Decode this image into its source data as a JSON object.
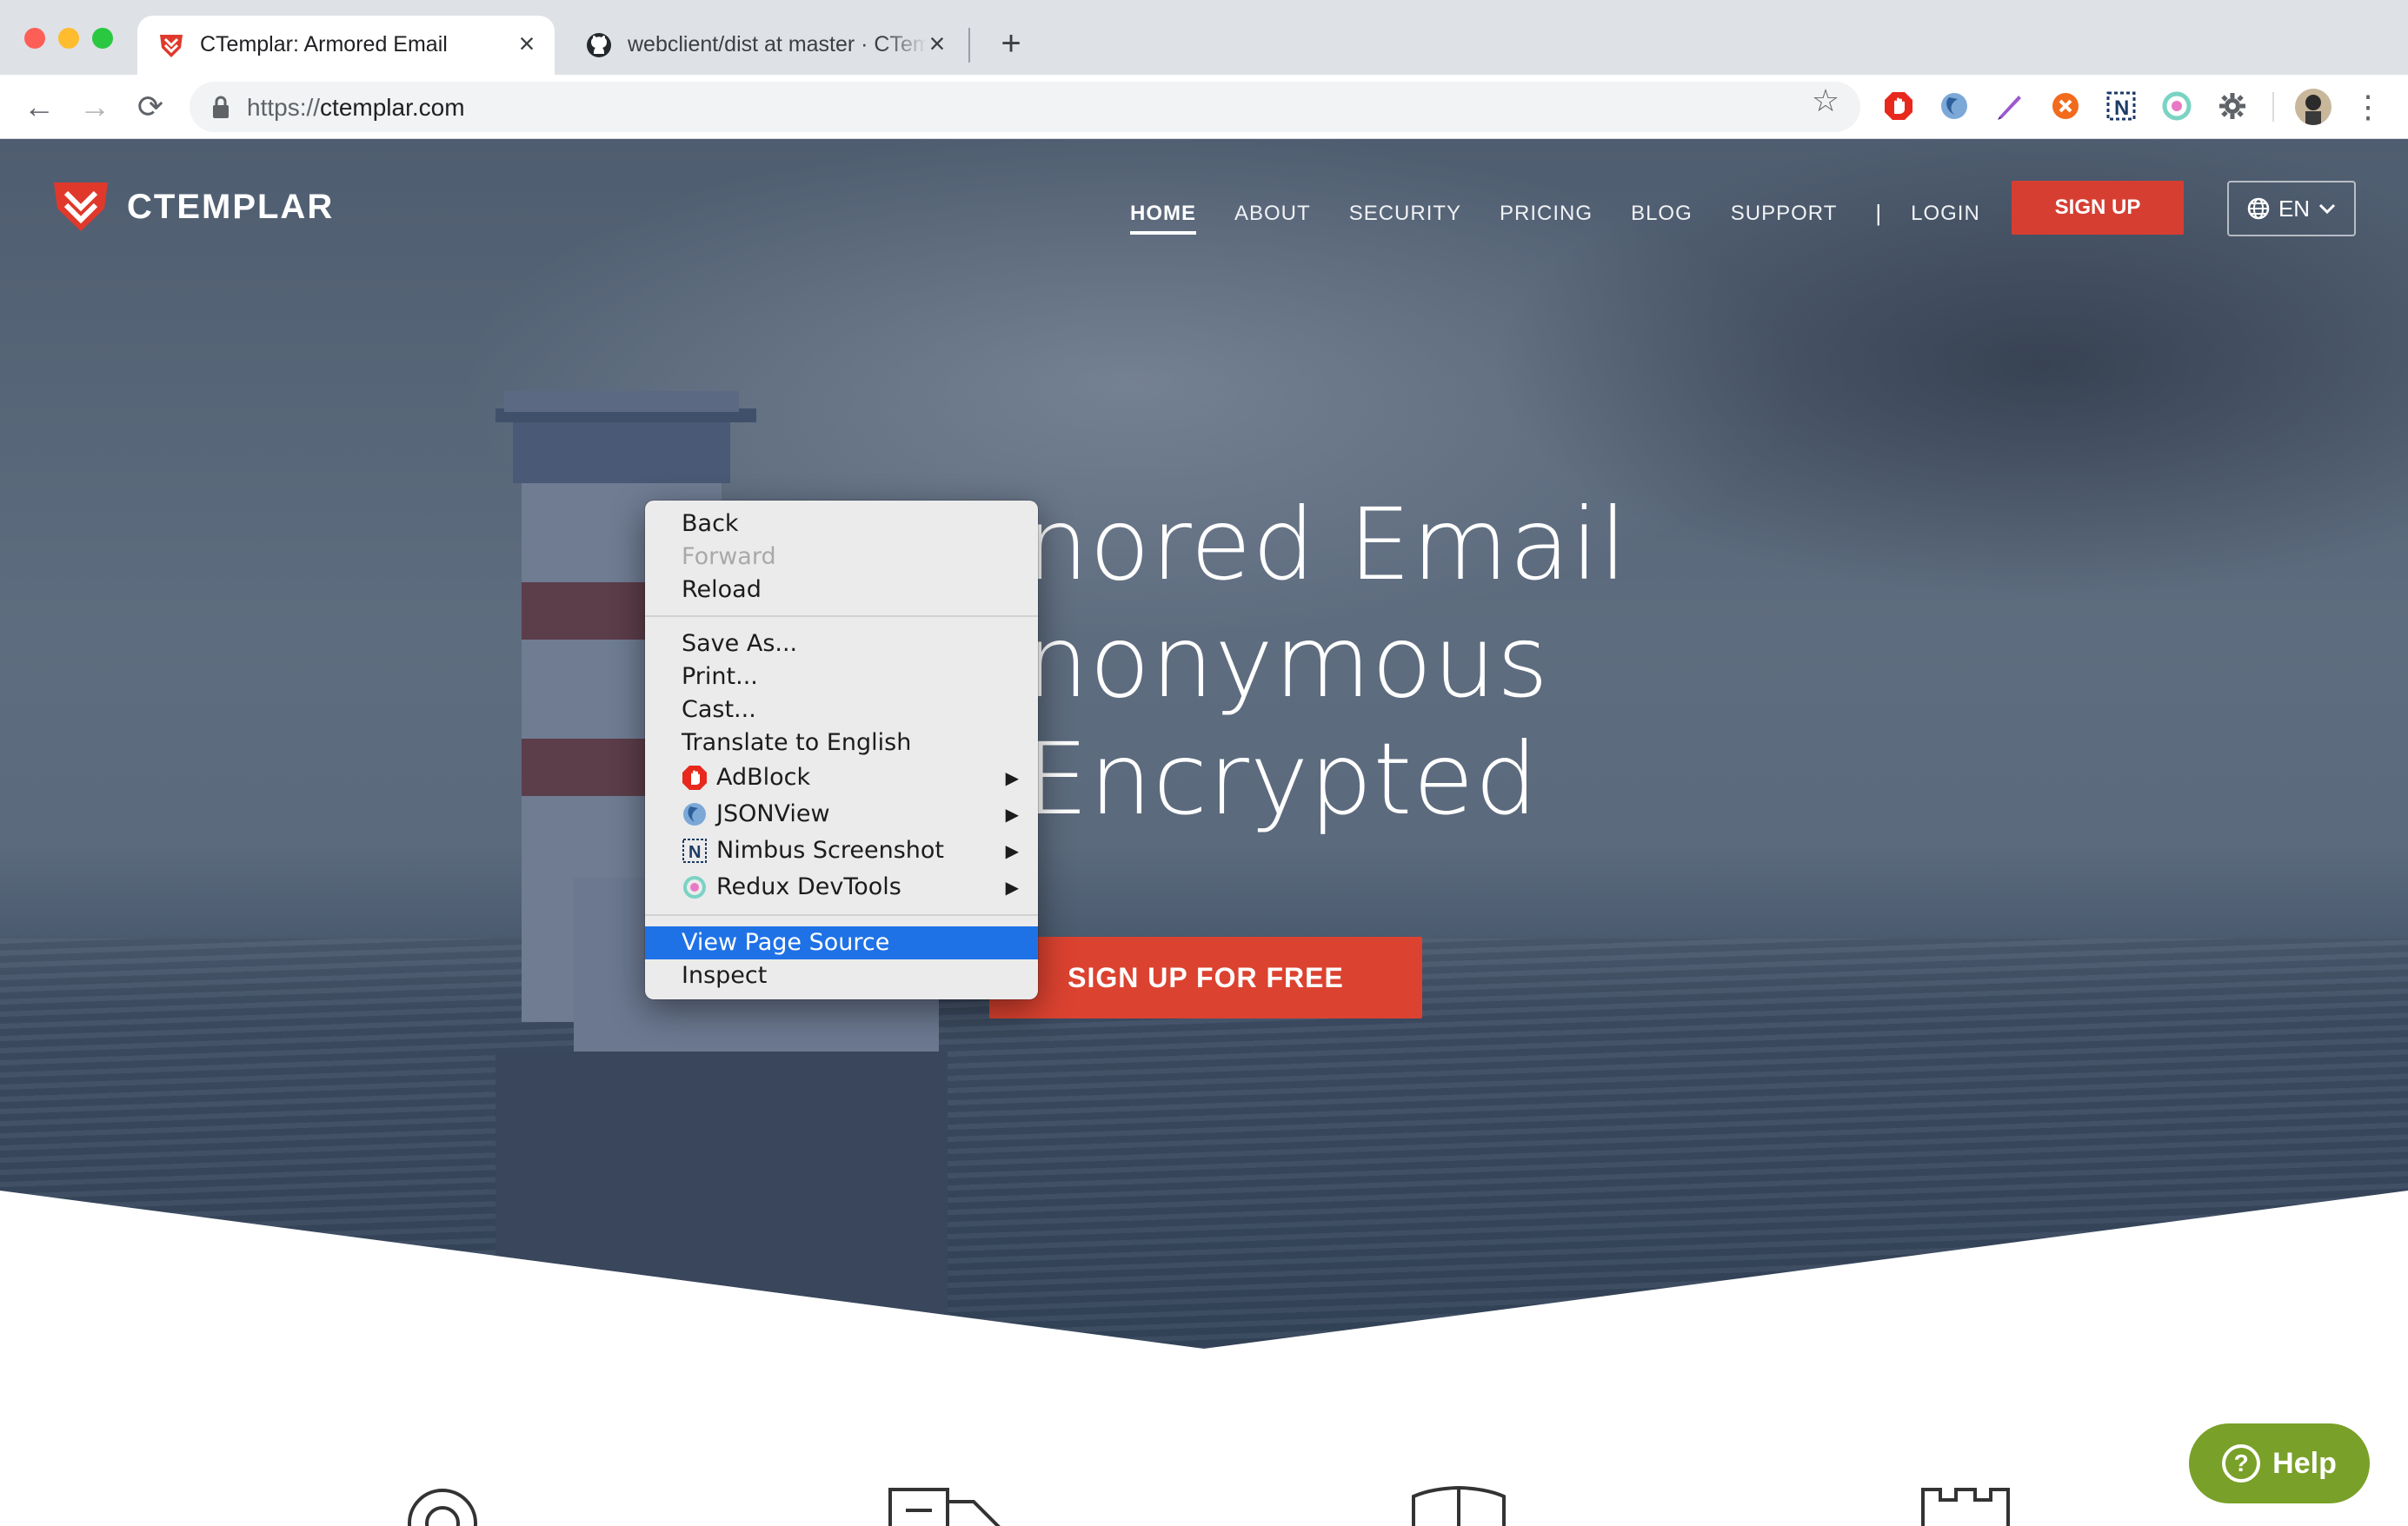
{
  "browser": {
    "tabs": [
      {
        "title": "CTemplar: Armored Email",
        "active": true,
        "close": "×"
      },
      {
        "title": "webclient/dist at master · CTemplar",
        "active": false,
        "close": "×"
      }
    ],
    "new_tab": "+",
    "url_scheme": "https://",
    "url_host": "ctemplar.com",
    "nav": {
      "back": "←",
      "forward": "→",
      "reload": "⟳",
      "star": "☆",
      "menu": "⋮"
    },
    "extensions": [
      "adblock-icon",
      "jsonview-icon",
      "pen-extension-icon",
      "orange-extension-icon",
      "nimbus-icon",
      "redux-devtools-icon",
      "puzzle-extension-icon"
    ]
  },
  "site": {
    "logo_text": "CTEMPLAR",
    "nav": [
      {
        "label": "HOME",
        "active": true
      },
      {
        "label": "ABOUT"
      },
      {
        "label": "SECURITY"
      },
      {
        "label": "PRICING"
      },
      {
        "label": "BLOG"
      },
      {
        "label": "SUPPORT"
      }
    ],
    "nav_separator": "|",
    "login": "LOGIN",
    "signup": "SIGN UP",
    "language": "EN",
    "hero_lines": [
      "nored Email",
      "nonymous",
      "Encrypted"
    ],
    "cta": "SIGN UP FOR FREE",
    "help": "Help",
    "help_glyph": "?"
  },
  "context_menu": {
    "items": [
      {
        "label": "Back",
        "disabled": false
      },
      {
        "label": "Forward",
        "disabled": true
      },
      {
        "label": "Reload",
        "disabled": false
      },
      {
        "label": "Save As...",
        "disabled": false
      },
      {
        "label": "Print...",
        "disabled": false
      },
      {
        "label": "Cast...",
        "disabled": false
      },
      {
        "label": "Translate to English",
        "disabled": false
      },
      {
        "label": "AdBlock",
        "icon": "adblock-icon",
        "submenu": true
      },
      {
        "label": "JSONView",
        "icon": "jsonview-icon",
        "submenu": true
      },
      {
        "label": "Nimbus Screenshot",
        "icon": "nimbus-icon",
        "submenu": true
      },
      {
        "label": "Redux DevTools",
        "icon": "redux-devtools-icon",
        "submenu": true
      },
      {
        "label": "View Page Source",
        "highlighted": true
      },
      {
        "label": "Inspect"
      }
    ],
    "submenu_arrow": "▶"
  },
  "colors": {
    "accent_red": "#dc4230",
    "menu_highlight": "#1f72e6",
    "help_green": "#79a028"
  }
}
